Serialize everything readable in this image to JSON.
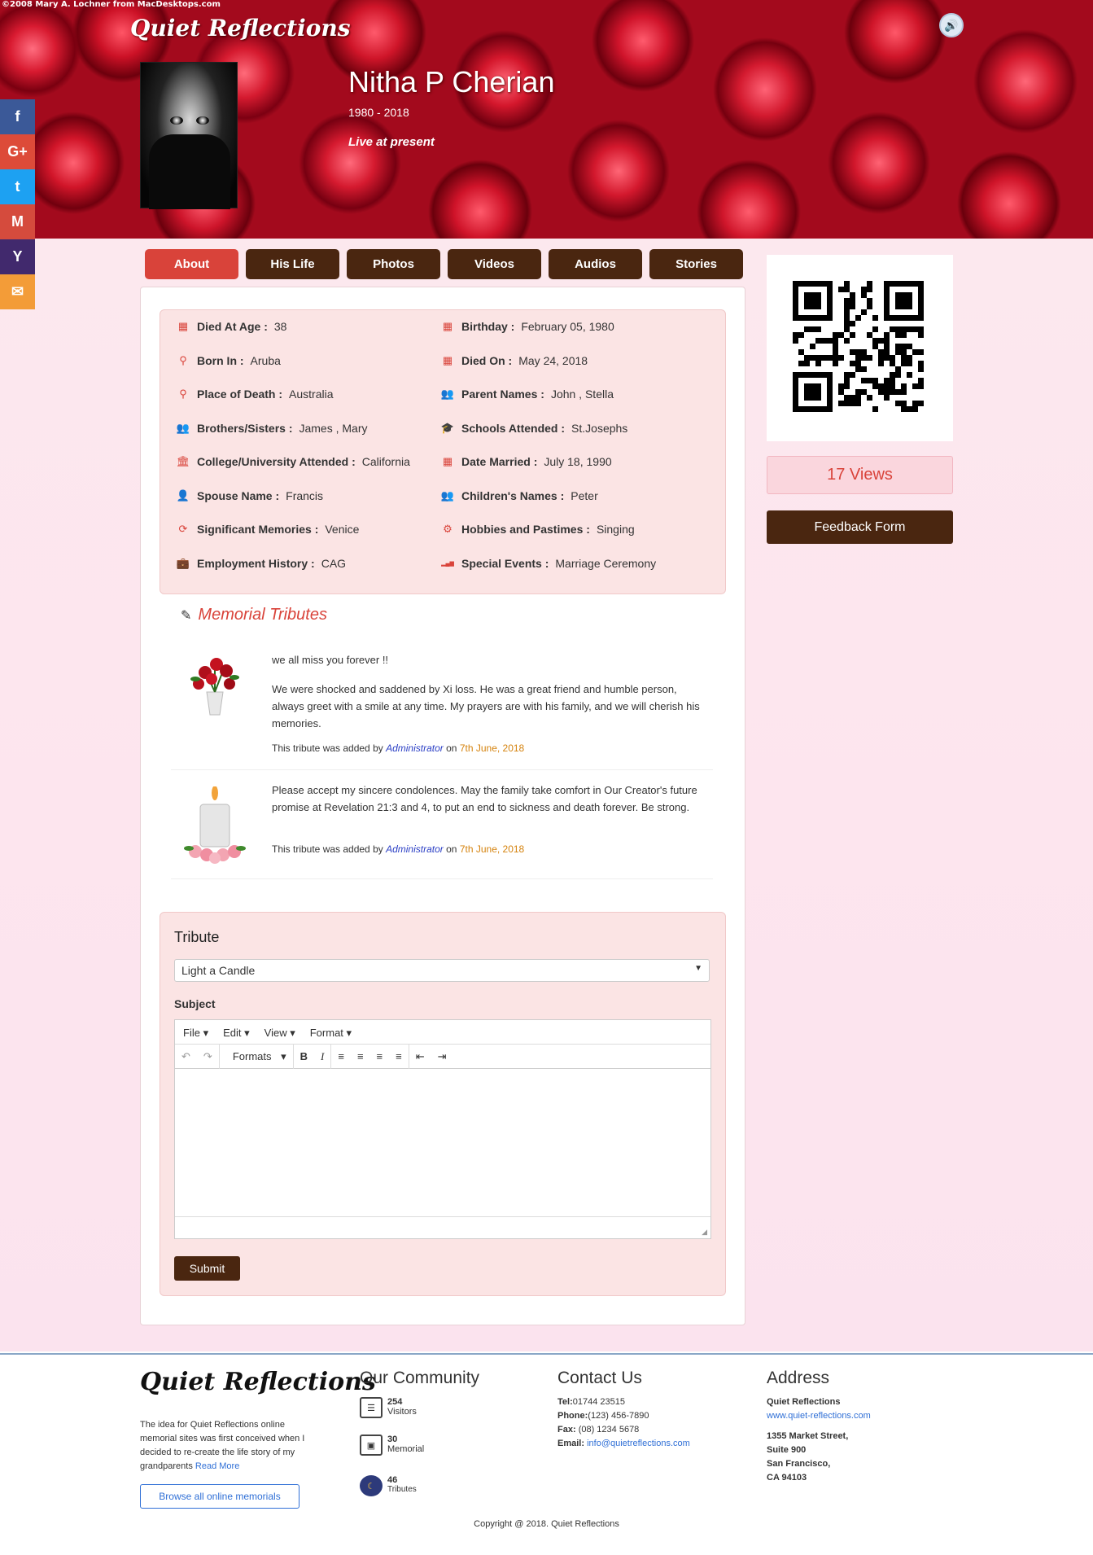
{
  "header": {
    "credit": "©2008 Mary A. Lochner    from MacDesktops.com",
    "brand": "Quiet Reflections",
    "name": "Nitha P Cherian",
    "years": "1980 - 2018",
    "status": "Live at present"
  },
  "social": [
    {
      "icon": "facebook-icon",
      "glyph": "f",
      "color": "#3b5998"
    },
    {
      "icon": "google-plus-icon",
      "glyph": "G+",
      "color": "#dd4b39"
    },
    {
      "icon": "twitter-icon",
      "glyph": "t",
      "color": "#1da1f2"
    },
    {
      "icon": "gmail-icon",
      "glyph": "M",
      "color": "#d54b3d"
    },
    {
      "icon": "yahoo-icon",
      "glyph": "Y",
      "color": "#41296d"
    },
    {
      "icon": "email-icon",
      "glyph": "✉",
      "color": "#f39c38"
    }
  ],
  "tabs": [
    "About",
    "His Life",
    "Photos",
    "Videos",
    "Audios",
    "Stories"
  ],
  "active_tab_color": "#d9433a",
  "info": {
    "left": [
      {
        "icon": "calendar-icon",
        "label": "Died At Age :",
        "value": "38"
      },
      {
        "icon": "location-pin-icon",
        "label": "Born In :",
        "value": "Aruba"
      },
      {
        "icon": "location-pin-icon",
        "label": "Place of Death :",
        "value": "Australia"
      },
      {
        "icon": "users-icon",
        "label": "Brothers/Sisters :",
        "value": "James , Mary"
      },
      {
        "icon": "university-icon",
        "label": "College/University Attended :",
        "value": "California"
      },
      {
        "icon": "user-icon",
        "label": "Spouse Name :",
        "value": "Francis"
      },
      {
        "icon": "refresh-icon",
        "label": "Significant Memories :",
        "value": "Venice"
      },
      {
        "icon": "briefcase-icon",
        "label": "Employment History :",
        "value": "CAG"
      }
    ],
    "right": [
      {
        "icon": "calendar-icon",
        "label": "Birthday :",
        "value": "February 05, 1980"
      },
      {
        "icon": "calendar-icon",
        "label": "Died On :",
        "value": "May 24, 2018"
      },
      {
        "icon": "users-icon",
        "label": "Parent Names :",
        "value": "John , Stella"
      },
      {
        "icon": "graduation-cap-icon",
        "label": "Schools Attended :",
        "value": "St.Josephs"
      },
      {
        "icon": "calendar-icon",
        "label": "Date Married :",
        "value": "July 18, 1990"
      },
      {
        "icon": "users-icon",
        "label": "Children's Names :",
        "value": "Peter"
      },
      {
        "icon": "gears-icon",
        "label": "Hobbies and Pastimes :",
        "value": "Singing"
      },
      {
        "icon": "signal-icon",
        "label": "Special Events :",
        "value": "Marriage Ceremony"
      }
    ]
  },
  "tributes": {
    "title": "Memorial Tributes",
    "items": [
      {
        "image": "roses-vase-image",
        "line1": "we all miss you forever !!",
        "body": "We were shocked and saddened by Xi loss. He was a great friend and humble person, always greet with a smile at any time.  My prayers are with his family, and we will cherish his memories.",
        "by_prefix": "This tribute was added by",
        "author": "Administrator",
        "on": "on",
        "date": "7th June, 2018"
      },
      {
        "image": "candle-image",
        "line1": "",
        "body": "Please accept my sincere condolences. May the family take comfort in Our Creator's future promise at Revelation 21:3 and 4,  to put an end to sickness and death forever. Be strong.",
        "by_prefix": "This tribute was added by",
        "author": "Administrator",
        "on": "on",
        "date": "7th June, 2018"
      }
    ]
  },
  "form": {
    "title": "Tribute",
    "select_value": "Light a Candle",
    "subject_label": "Subject",
    "menu": [
      "File",
      "Edit",
      "View",
      "Format"
    ],
    "formats_label": "Formats",
    "submit": "Submit"
  },
  "sidebar": {
    "views": "17 Views",
    "feedback": "Feedback Form"
  },
  "footer": {
    "brand": "Quiet Reflections",
    "about": "The idea for Quiet Reflections online memorial sites was first conceived when I decided to re-create the life story of my grandparents",
    "read_more": "Read More",
    "browse": "Browse all online memorials",
    "community_title": "Our Community",
    "stats": [
      {
        "icon": "visitors-icon",
        "value": "254",
        "label": "Visitors"
      },
      {
        "icon": "memorial-icon",
        "value": "30",
        "label": "Memorial"
      },
      {
        "icon": "tributes-icon",
        "value": "46",
        "label": "Tributes"
      }
    ],
    "contact_title": "Contact Us",
    "tel": "01744 23515",
    "phone": "(123) 456-7890",
    "fax": "(08) 1234 5678",
    "email": "info@quietreflections.com",
    "address_title": "Address",
    "addr_name": "Quiet Reflections",
    "addr_web": "www.quiet-reflections.com",
    "addr_street": "1355 Market Street,",
    "addr_suite": "Suite 900",
    "addr_city": "San Francisco,",
    "addr_zip": "CA 94103",
    "copyright": "Copyright @ 2018. Quiet Reflections"
  }
}
